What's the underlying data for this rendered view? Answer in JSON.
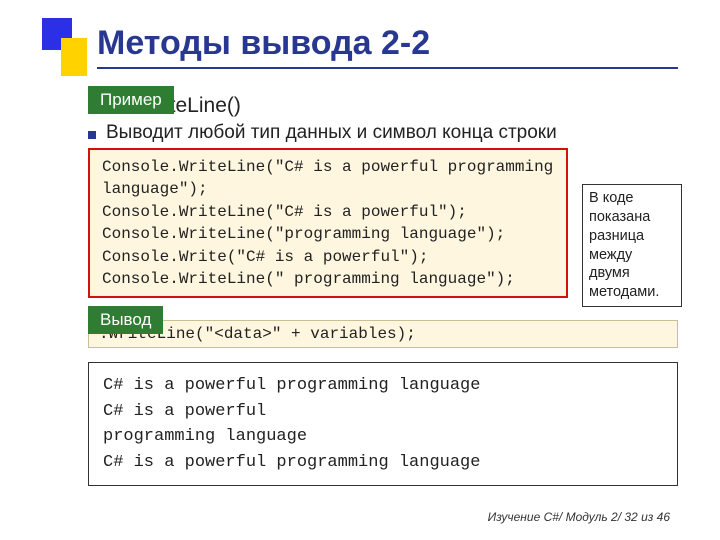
{
  "title": "Методы вывода 2-2",
  "heading_method": "riteLine()",
  "heading_full_hidden": "Console.WriteLine()",
  "sub_text": "Выводит любой тип данных и символ конца строки",
  "labels": {
    "example": "Пример",
    "output": "Вывод"
  },
  "code_example": [
    "Console.WriteLine(\"C# is a powerful programming",
    "language\");",
    "Console.WriteLine(\"C# is a powerful\");",
    "Console.WriteLine(\"programming language\");",
    "Console.Write(\"C# is a powerful\");",
    "Console.WriteLine(\" programming language\");"
  ],
  "code_template": ".WriteLine(\"<data>\" + variables);",
  "note": "В коде показана разница между двумя методами.",
  "output_lines": [
    "C# is a powerful programming language",
    "C# is a powerful",
    "programming language",
    "C# is a powerful programming language"
  ],
  "footer": "Изучение C#/ Модуль 2/ 32 из 46"
}
